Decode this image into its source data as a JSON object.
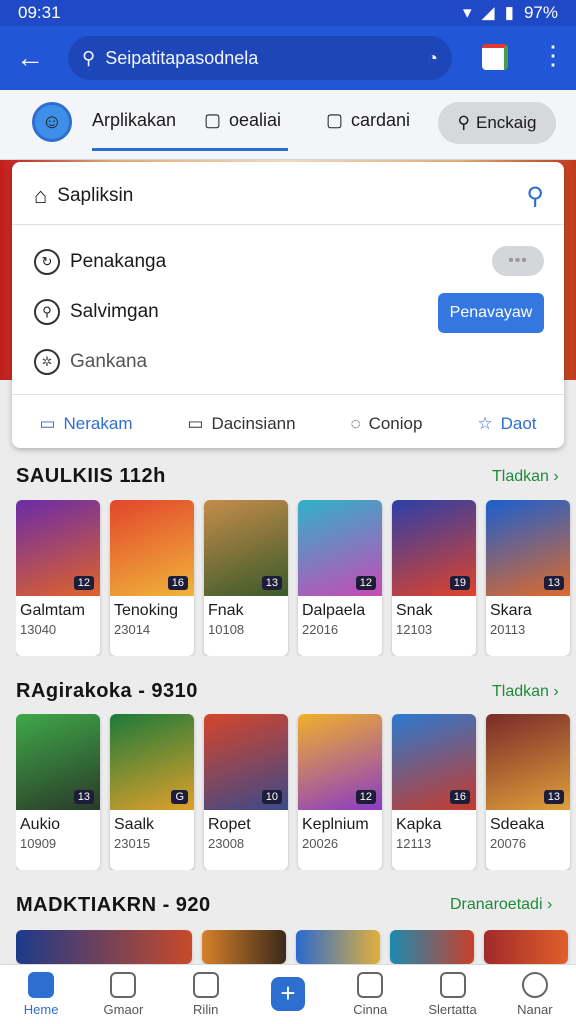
{
  "status_bar": {
    "time": "09:31",
    "battery": "97%"
  },
  "search": {
    "placeholder": "Seipatitapasodnela"
  },
  "tabs": [
    {
      "label": "Arplikakan"
    },
    {
      "label": "oealiai"
    },
    {
      "label": "cardani"
    },
    {
      "label": "Enckaig"
    }
  ],
  "panel": {
    "title": "Sapliksin",
    "item1": {
      "label": "Penakanga"
    },
    "item2": {
      "label": "Salvimgan",
      "button": "Penavayaw"
    },
    "item3": {
      "label": "Gankana"
    },
    "bottom_tabs": [
      {
        "label": "Nerakam"
      },
      {
        "label": "Dacinsiann"
      },
      {
        "label": "Coniop"
      },
      {
        "label": "Daot"
      }
    ]
  },
  "sections": [
    {
      "title": "SAULKIIS 112h",
      "link": "Tladkan",
      "cards": [
        {
          "name": "Galmtam",
          "num": "13040",
          "badge": "12"
        },
        {
          "name": "Tenoking",
          "num": "23014",
          "badge": "16"
        },
        {
          "name": "Fnak",
          "num": "10108",
          "badge": "13"
        },
        {
          "name": "Dalpaela",
          "num": "22016",
          "badge": "12"
        },
        {
          "name": "Snak",
          "num": "12103",
          "badge": "19"
        },
        {
          "name": "Skara",
          "num": "20113",
          "badge": "13"
        }
      ]
    },
    {
      "title": "RAgirakoka - 9310",
      "link": "Tladkan",
      "cards": [
        {
          "name": "Aukio",
          "num": "10909",
          "badge": "13"
        },
        {
          "name": "Saalk",
          "num": "23015",
          "badge": "G"
        },
        {
          "name": "Ropet",
          "num": "23008",
          "badge": "10"
        },
        {
          "name": "Keplnium",
          "num": "20026",
          "badge": "12"
        },
        {
          "name": "Kapka",
          "num": "12113",
          "badge": "16"
        },
        {
          "name": "Sdeaka",
          "num": "20076",
          "badge": "13"
        }
      ]
    },
    {
      "title": "MADKTIAKRN - 920",
      "link": "Dranaroetadi"
    }
  ],
  "nav": [
    {
      "label": "Heme"
    },
    {
      "label": "Gmaor"
    },
    {
      "label": "Rilin"
    },
    {
      "label": ""
    },
    {
      "label": "Cinna"
    },
    {
      "label": "Slertatta"
    },
    {
      "label": "Nanar"
    }
  ],
  "colors": {
    "primary": "#2156d6",
    "accent": "#2d6fd0",
    "link_green": "#1f8a3a"
  }
}
